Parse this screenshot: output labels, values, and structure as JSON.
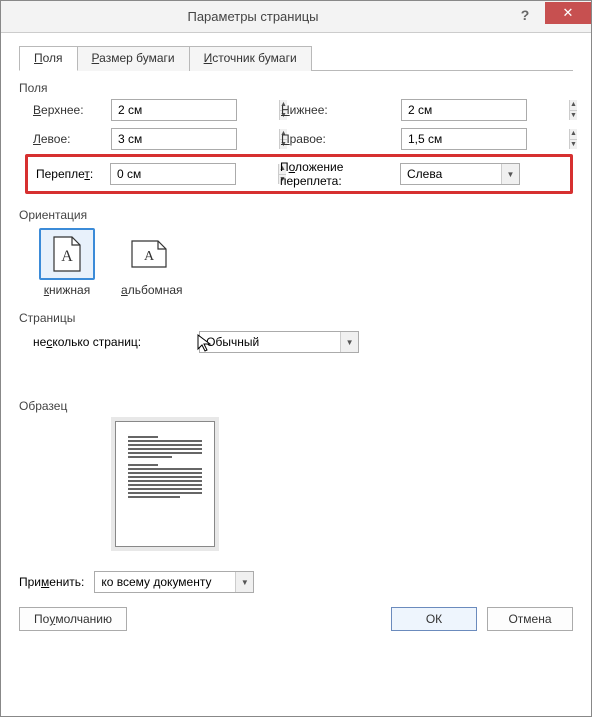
{
  "titlebar": {
    "title": "Параметры страницы",
    "help": "?",
    "close": "✕"
  },
  "tabs": {
    "t1": "Поля",
    "t2": "Размер бумаги",
    "t3": "Источник бумаги"
  },
  "section_margins": "Поля",
  "margins": {
    "top_label": "Верхнее:",
    "top_value": "2 см",
    "bottom_label": "Нижнее:",
    "bottom_value": "2 см",
    "left_label": "Левое:",
    "left_value": "3 см",
    "right_label": "Правое:",
    "right_value": "1,5 см",
    "gutter_label": "Переплет:",
    "gutter_value": "0 см",
    "gutter_pos_label": "Положение переплета:",
    "gutter_pos_value": "Слева"
  },
  "section_orientation": "Ориентация",
  "orientation": {
    "portrait": "книжная",
    "landscape": "альбомная"
  },
  "section_pages": "Страницы",
  "pages": {
    "multi_label": "несколько страниц:",
    "multi_value": "Обычный"
  },
  "section_preview": "Образец",
  "apply": {
    "label": "Применить:",
    "value": "ко всему документу"
  },
  "buttons": {
    "default": "По умолчанию",
    "ok": "ОК",
    "cancel": "Отмена"
  }
}
